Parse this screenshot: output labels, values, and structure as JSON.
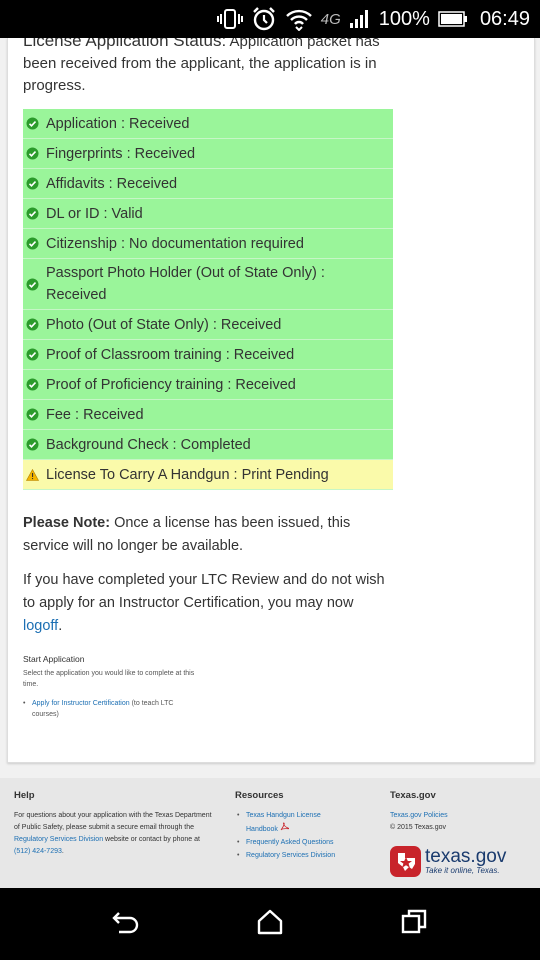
{
  "statusbar": {
    "battery": "100%",
    "time": "06:49",
    "network": "4G"
  },
  "application": {
    "status_label": "License Application Status:",
    "status_text": "Application packet has been received from the applicant, the application is in progress.",
    "items": [
      {
        "text": "Application : Received",
        "state": "ok"
      },
      {
        "text": "Fingerprints : Received",
        "state": "ok"
      },
      {
        "text": "Affidavits : Received",
        "state": "ok"
      },
      {
        "text": "DL or ID : Valid",
        "state": "ok"
      },
      {
        "text": "Citizenship : No documentation required",
        "state": "ok"
      },
      {
        "text": "Passport Photo Holder (Out of State Only) : Received",
        "state": "ok"
      },
      {
        "text": "Photo (Out of State Only) : Received",
        "state": "ok"
      },
      {
        "text": "Proof of Classroom training : Received",
        "state": "ok"
      },
      {
        "text": "Proof of Proficiency training : Received",
        "state": "ok"
      },
      {
        "text": "Fee : Received",
        "state": "ok"
      },
      {
        "text": "Background Check : Completed",
        "state": "ok"
      },
      {
        "text": "License To Carry A Handgun : Print Pending",
        "state": "warning"
      }
    ]
  },
  "note": {
    "bold": "Please Note:",
    "text": " Once a license has been issued, this service will no longer be available."
  },
  "ltc": {
    "text_before": "If you have completed your LTC Review and do not wish to apply for an Instructor Certification, you may now ",
    "link": "logoff",
    "text_after": "."
  },
  "start_application": {
    "title": "Start Application",
    "description": "Select the application you would like to complete at this time.",
    "link": "Apply for Instructor Certification",
    "link_suffix": " (to teach LTC courses)"
  },
  "footer": {
    "help": {
      "title": "Help",
      "text_1": "For questions about your application with the Texas Department of Public Safety, please submit a secure email through the ",
      "link_1": "Regulatory Services Division",
      "text_2": " website or contact by phone at ",
      "phone": "(512) 424-7293",
      "text_3": "."
    },
    "resources": {
      "title": "Resources",
      "links": [
        "Texas Handgun License Handbook",
        "Frequently Asked Questions",
        "Regulatory Services Division"
      ]
    },
    "texasgov": {
      "title": "Texas.gov",
      "policies_link": "Texas.gov Policies",
      "copyright": "© 2015 Texas.gov",
      "logo_word": "texas.gov",
      "logo_tagline": "Take it online, Texas."
    }
  },
  "colors": {
    "ok_row": "#9af59a",
    "warning_row": "#fafaaa",
    "link": "#1c6fb3",
    "texas_red": "#c8242b"
  }
}
